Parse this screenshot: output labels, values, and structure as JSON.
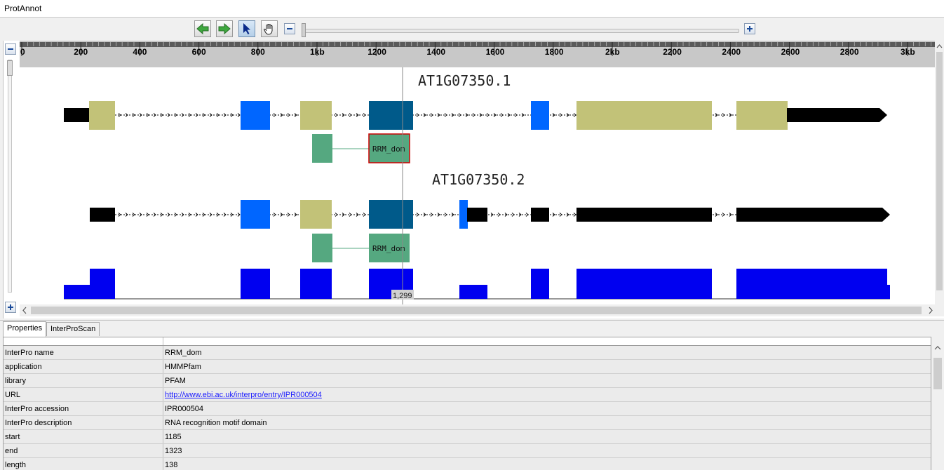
{
  "app": {
    "title": "ProtAnnot"
  },
  "toolbar": {
    "buttons": [
      {
        "name": "scroll-left-button",
        "icon": "green-arrow-left-icon"
      },
      {
        "name": "scroll-right-button",
        "icon": "green-arrow-right-icon"
      },
      {
        "name": "select-tool-button",
        "icon": "arrow-cursor-icon",
        "selected": true
      },
      {
        "name": "pan-tool-button",
        "icon": "hand-icon"
      },
      {
        "name": "zoom-out-button",
        "icon": "minus-icon"
      },
      {
        "name": "zoom-in-button",
        "icon": "plus-icon"
      }
    ]
  },
  "ruler": {
    "ticks": [
      "0",
      "200",
      "400",
      "600",
      "800",
      "1kb",
      "1200",
      "1400",
      "1600",
      "1800",
      "2kb",
      "2200",
      "2400",
      "2600",
      "2800",
      "3kb"
    ],
    "cursor_label": "1,299"
  },
  "transcripts": [
    {
      "name": "AT1G07350.1",
      "domain_label": "RRM_dom"
    },
    {
      "name": "AT1G07350.2",
      "domain_label": "RRM_dom"
    }
  ],
  "colors": {
    "utr": "#000000",
    "exon_olive": "#c2c278",
    "exon_blue": "#0066ff",
    "exon_dark": "#005a8a",
    "domain": "#55a880",
    "selection": "#cc0000",
    "coverage": "#0000f0"
  },
  "tabs": [
    {
      "label": "Properties",
      "active": true
    },
    {
      "label": "InterProScan",
      "active": false
    }
  ],
  "properties": [
    {
      "key": "InterPro name",
      "value": "RRM_dom"
    },
    {
      "key": "application",
      "value": "HMMPfam"
    },
    {
      "key": "library",
      "value": "PFAM"
    },
    {
      "key": "URL",
      "value": "http://www.ebi.ac.uk/interpro/entry/IPR000504",
      "link": true
    },
    {
      "key": "InterPro accession",
      "value": "IPR000504"
    },
    {
      "key": "InterPro description",
      "value": "RNA recognition motif domain"
    },
    {
      "key": "start",
      "value": "1185"
    },
    {
      "key": "end",
      "value": "1323"
    },
    {
      "key": "length",
      "value": "138"
    }
  ]
}
